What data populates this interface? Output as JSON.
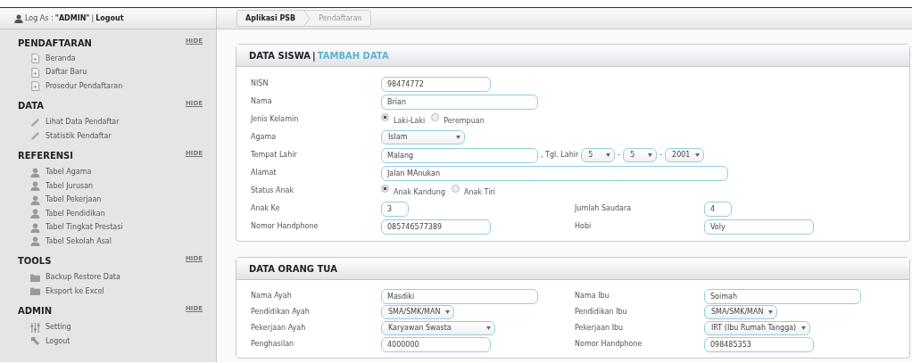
{
  "user_bar": {
    "prefix": "Log As :",
    "user": "\"ADMIN\"",
    "separator": "|",
    "logout": "Logout"
  },
  "sidebar": {
    "sections": [
      {
        "title": "PENDAFTARAN",
        "toggle": "HIDE",
        "items": [
          {
            "label": "Beranda",
            "kind": "page"
          },
          {
            "label": "Daftar Baru",
            "kind": "page"
          },
          {
            "label": "Prosedur Pendaftaran",
            "kind": "page"
          }
        ]
      },
      {
        "title": "DATA",
        "toggle": "HIDE",
        "items": [
          {
            "label": "Lihat Data Pendaftar",
            "kind": "edit"
          },
          {
            "label": "Statistik Pendaftar",
            "kind": "edit"
          }
        ]
      },
      {
        "title": "REFERENSI",
        "toggle": "HIDE",
        "items": [
          {
            "label": "Tabel Agama",
            "kind": "table"
          },
          {
            "label": "Tabel Jurusan",
            "kind": "table"
          },
          {
            "label": "Tabel Pekerjaan",
            "kind": "table"
          },
          {
            "label": "Tabel Pendidikan",
            "kind": "table"
          },
          {
            "label": "Tabel Tingkat Prestasi",
            "kind": "table"
          },
          {
            "label": "Tabel Sekolah Asal",
            "kind": "table"
          }
        ]
      },
      {
        "title": "TOOLS",
        "toggle": "HIDE",
        "items": [
          {
            "label": "Backup Restore Data",
            "kind": "folder"
          },
          {
            "label": "Eksport ke Excel",
            "kind": "folder"
          }
        ]
      },
      {
        "title": "ADMIN",
        "toggle": "HIDE",
        "items": [
          {
            "label": "Setting",
            "kind": "setting"
          },
          {
            "label": "Logout",
            "kind": "logout"
          }
        ]
      }
    ]
  },
  "breadcrumb": [
    {
      "label": "Aplikasi PSB",
      "current": false
    },
    {
      "label": "Pendaftaran",
      "current": true
    }
  ],
  "cards": [
    {
      "title": "DATA SISWA",
      "separator": "|",
      "link": "TAMBAH DATA",
      "rows": [
        [
          {
            "label": "NISN",
            "kind": "text",
            "value": "98474772"
          }
        ],
        [
          {
            "label": "Nama",
            "kind": "text",
            "value": "Brian"
          }
        ],
        [
          {
            "label": "Jenis Kelamin",
            "kind": "radio",
            "options": [
              {
                "label": "Laki-Laki",
                "selected": true
              },
              {
                "label": "Perempuan",
                "selected": false
              }
            ]
          }
        ],
        [
          {
            "label": "Agama",
            "kind": "select",
            "value": "Islam"
          }
        ],
        [
          {
            "label": "Tempat Lahir",
            "kind": "birth",
            "value": "Malang",
            "date_label": ", Tgl. Lahir",
            "day": "5",
            "month": "5",
            "year": "2001",
            "dash": "-"
          }
        ],
        [
          {
            "label": "Alamat",
            "kind": "text",
            "value": "Jalan MAnukan"
          }
        ],
        [
          {
            "label": "Status Anak",
            "kind": "radio",
            "options": [
              {
                "label": "Anak Kandung",
                "selected": true
              },
              {
                "label": "Anak Tiri",
                "selected": false
              }
            ]
          }
        ],
        [
          {
            "label": "Anak Ke",
            "kind": "text",
            "value": "3"
          },
          {
            "label": "Jumlah Saudara",
            "kind": "text",
            "value": "4"
          }
        ],
        [
          {
            "label": "Nomor Handphone",
            "kind": "text",
            "value": "085746577389"
          },
          {
            "label": "Hobi",
            "kind": "text",
            "value": "Voly"
          }
        ]
      ]
    },
    {
      "title": "DATA ORANG TUA",
      "rows": [
        [
          {
            "label": "Nama Ayah",
            "kind": "text",
            "value": "Masdiki"
          },
          {
            "label": "Nama Ibu",
            "kind": "text",
            "value": "Soimah"
          }
        ],
        [
          {
            "label": "Pendidikan Ayah",
            "kind": "select",
            "value": "SMA/SMK/MAN"
          },
          {
            "label": "Pendidikan Ibu",
            "kind": "select",
            "value": "SMA/SMK/MAN"
          }
        ],
        [
          {
            "label": "Pekerjaan Ayah",
            "kind": "select",
            "value": "Karyawan Swasta"
          },
          {
            "label": "Pekerjaan Ibu",
            "kind": "select",
            "value": "IRT (Ibu Rumah Tangga)"
          }
        ],
        [
          {
            "label": "Penghasilan",
            "kind": "text",
            "value": "4000000"
          },
          {
            "label": "Nomor Handphone",
            "kind": "text",
            "value": "098485353"
          }
        ]
      ]
    }
  ]
}
